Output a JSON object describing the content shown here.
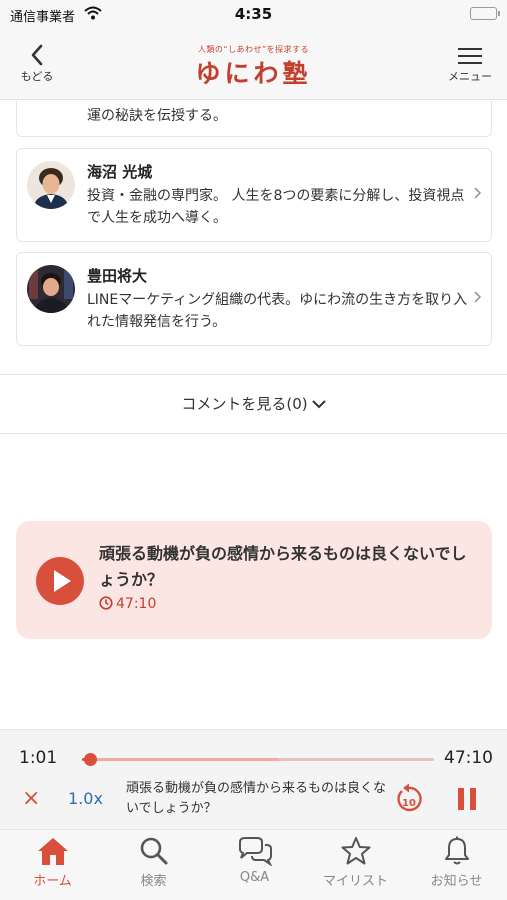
{
  "status_bar": {
    "carrier": "通信事業者",
    "time": "4:35"
  },
  "header": {
    "back_label": "もどる",
    "logo_tagline": "人類の“しあわせ”を探求する",
    "logo_text": "ゆにわ塾",
    "menu_label": "メニュー"
  },
  "instructors": [
    {
      "name": "",
      "bio": "運の秘訣を伝授する。"
    },
    {
      "name": "海沼 光城",
      "bio": "投資・金融の専門家。 人生を8つの要素に分解し、投資視点で人生を成功へ導く。"
    },
    {
      "name": "豊田将大",
      "bio": "LINEマーケティング組織の代表。ゆにわ流の生き方を取り入れた情報発信を行う。"
    }
  ],
  "comments": {
    "label": "コメントを見る(0)"
  },
  "episode": {
    "title": "頑張る動機が負の感情から来るものは良くないでしょうか？",
    "duration": "47:10"
  },
  "player": {
    "current_time": "1:01",
    "total_time": "47:10",
    "progress_fraction": 0.0216,
    "buffered_fraction": 0.56,
    "close_symbol": "×",
    "speed": "1.0x",
    "title": "頑張る動機が負の感情から来るものは良くないでしょうか？",
    "rewind_seconds": "10"
  },
  "tabs": [
    {
      "label": "ホーム",
      "icon": "home-icon",
      "active": true
    },
    {
      "label": "検索",
      "icon": "search-icon",
      "active": false
    },
    {
      "label": "Q&A",
      "icon": "chat-bubbles-icon",
      "active": false
    },
    {
      "label": "マイリスト",
      "icon": "star-icon",
      "active": false
    },
    {
      "label": "お知らせ",
      "icon": "bell-icon",
      "active": false
    }
  ],
  "colors": {
    "accent": "#d8503c",
    "logo": "#c4402e",
    "episode_bg": "#fbe6e3",
    "speed": "#2b6fb6"
  }
}
